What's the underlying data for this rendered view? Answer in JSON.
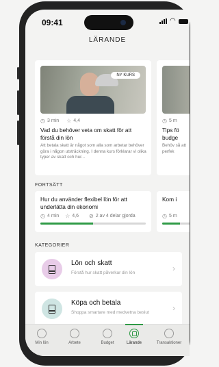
{
  "status_bar": {
    "time": "09:41"
  },
  "header": {
    "title": "LÄRANDE"
  },
  "featured": [
    {
      "badge": "NY KURS",
      "duration": "3 min",
      "rating": "4,4",
      "title": "Vad du behöver veta om skatt för att förstå din lön",
      "description": "Att betala skatt är något som alla som arbetar behöver göra i någon utsträckning. I denna kurs förklarar vi olika typer av skatt och hur..."
    },
    {
      "duration": "5 m",
      "title": "Tips fö budge",
      "description": "Behöv så att perfek"
    }
  ],
  "continue_section": {
    "label": "FORTSÄTT",
    "items": [
      {
        "title": "Hur du använder flexibel lön för att underlätta din ekonomi",
        "duration": "4 min",
        "rating": "4,6",
        "progress_text": "2 av 4 delar gjorda",
        "progress": 0.5
      },
      {
        "title": "Kom i",
        "duration": "5 m",
        "progress": 0.5
      }
    ]
  },
  "categories_section": {
    "label": "KATEGORIER",
    "items": [
      {
        "title": "Lön och skatt",
        "subtitle": "Förstå hur skatt påverkar din lön",
        "color": "#e8cce8"
      },
      {
        "title": "Köpa och betala",
        "subtitle": "Shoppa smartare med medvetna beslut",
        "color": "#cfe5e3"
      }
    ]
  },
  "tabs": [
    {
      "label": "Min lön",
      "icon": "salary-icon"
    },
    {
      "label": "Arbete",
      "icon": "work-icon"
    },
    {
      "label": "Budget",
      "icon": "budget-icon"
    },
    {
      "label": "Lärande",
      "icon": "learning-icon",
      "active": true
    },
    {
      "label": "Transaktioner",
      "icon": "transactions-icon"
    }
  ],
  "colors": {
    "accent": "#2f9a46"
  }
}
